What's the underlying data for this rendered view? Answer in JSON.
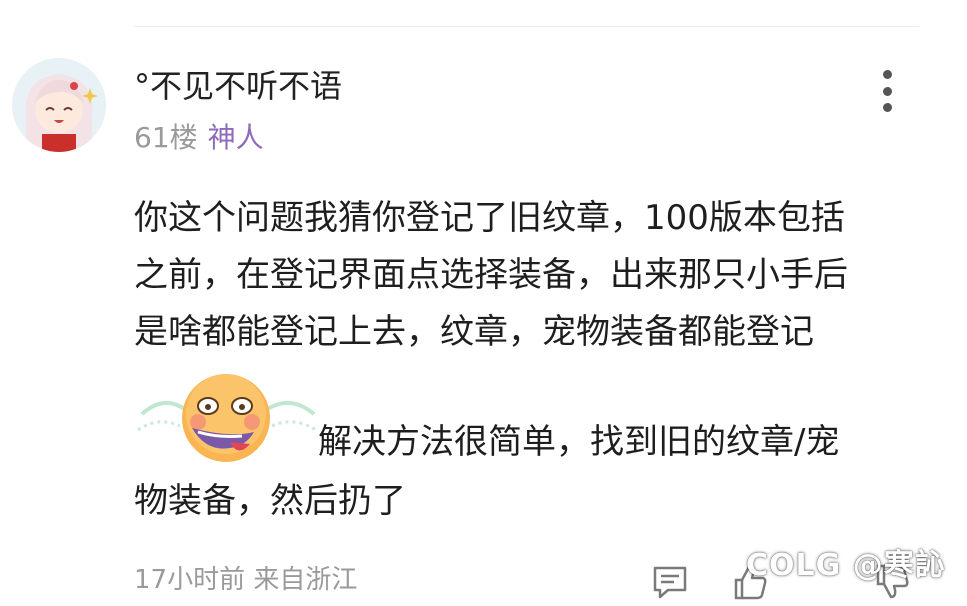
{
  "comment": {
    "username": "°不见不听不语",
    "floor": "61楼",
    "badge": "神人",
    "lines": [
      "你这个问题我猜你登记了旧纹章，100版本包括",
      "之前，在登记界面点选择装备，出来那只小手后",
      "是啥都能登记上去，纹章，宠物装备都能登记",
      "解决方法很简单，找到旧的纹章/宠",
      "物装备，然后扔了"
    ],
    "time_location": "17小时前 来自浙江"
  },
  "watermark": {
    "text": "COLG @寒訫"
  },
  "icons": {
    "more": "more-vertical-icon",
    "reply": "comment-icon",
    "like": "thumbs-up-icon",
    "dislike": "thumbs-down-icon",
    "emoji": "laughing-crying-emoji-icon"
  },
  "colors": {
    "badge": "#8e6ab8",
    "meta": "#9a9a9a",
    "text": "#1e1e1e"
  }
}
